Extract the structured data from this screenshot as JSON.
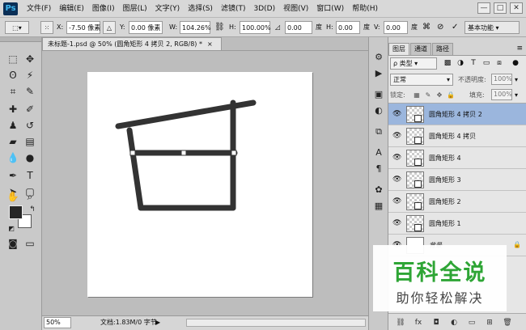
{
  "app": {
    "logo": "Ps"
  },
  "menu": [
    "文件(F)",
    "编辑(E)",
    "图像(I)",
    "图层(L)",
    "文字(Y)",
    "选择(S)",
    "滤镜(T)",
    "3D(D)",
    "视图(V)",
    "窗口(W)",
    "帮助(H)"
  ],
  "window_controls": {
    "minimize": "—",
    "maximize": "□",
    "close": "✕"
  },
  "options": {
    "x_label": "X:",
    "x_value": "-7.50 像素",
    "y_label": "Y:",
    "y_value": "0.00 像素",
    "w_label": "W:",
    "w_value": "104.26%",
    "h_label": "H:",
    "h_value": "100.00%",
    "angle_value": "0.00",
    "angle_unit": "度",
    "hskew_label": "H:",
    "hskew_value": "0.00",
    "hskew_unit": "度",
    "vskew_label": "V:",
    "vskew_value": "0.00",
    "vskew_unit": "度",
    "workspace": "基本功能"
  },
  "document": {
    "tab_title": "未标题-1.psd @ 50% (圆角矩形 4 拷贝 2, RGB/8) *",
    "tab_close": "×",
    "zoom": "50%",
    "doc_info": "文档:1.83M/0 字节",
    "status_arrow": "▶"
  },
  "layers_panel": {
    "tabs": [
      "图层",
      "通道",
      "路径"
    ],
    "menu_icon": "≡",
    "filter_kind": "ρ 类型",
    "blend_mode": "正常",
    "opacity_label": "不透明度:",
    "opacity_value": "100%",
    "lock_label": "锁定:",
    "fill_label": "填充:",
    "fill_value": "100%",
    "layers": [
      {
        "name": "圆角矩形 4 拷贝 2",
        "selected": true
      },
      {
        "name": "圆角矩形 4 拷贝",
        "selected": false
      },
      {
        "name": "圆角矩形 4",
        "selected": false
      },
      {
        "name": "圆角矩形 3",
        "selected": false
      },
      {
        "name": "圆角矩形 2",
        "selected": false
      },
      {
        "name": "圆角矩形 1",
        "selected": false
      },
      {
        "name": "背景",
        "selected": false
      }
    ]
  },
  "watermark": {
    "title": "百科全说",
    "subtitle": "助你轻松解决"
  },
  "colors": {
    "foreground": "#262626",
    "background": "#ffffff",
    "selected_layer": "#9bb6dd",
    "watermark_green": "#2ea535"
  }
}
